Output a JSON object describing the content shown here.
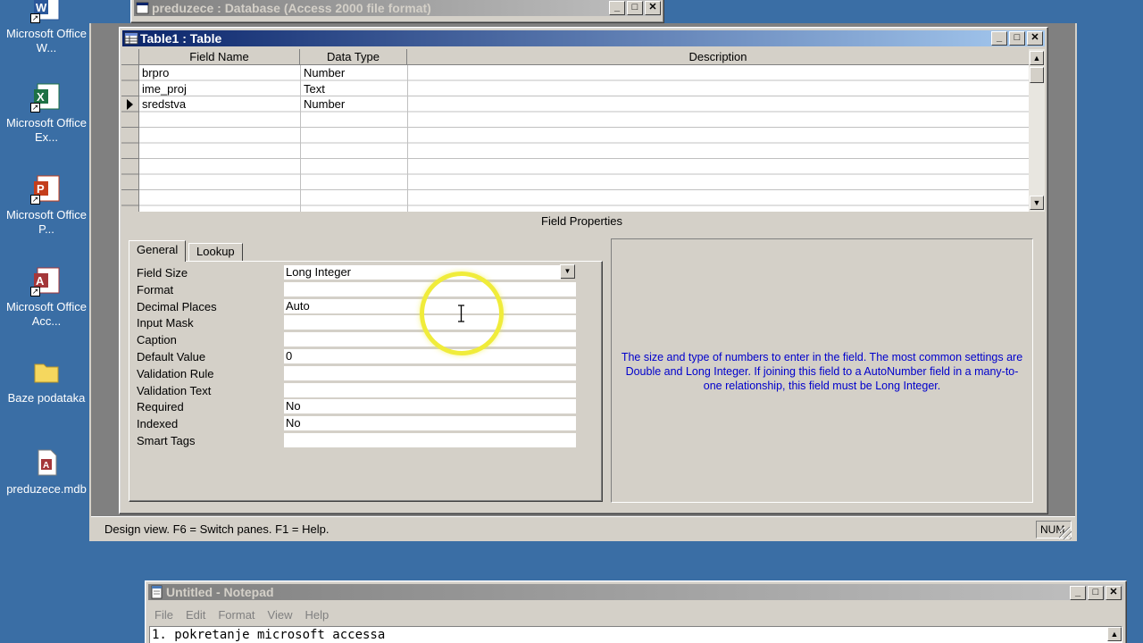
{
  "desktop": {
    "icons": [
      {
        "label": "Microsoft Office W...",
        "icon": "word-icon",
        "color": "#2b579a"
      },
      {
        "label": "Microsoft Office Ex...",
        "icon": "excel-icon",
        "color": "#1e7145"
      },
      {
        "label": "Microsoft Office P...",
        "icon": "powerpoint-icon",
        "color": "#c43e1c"
      },
      {
        "label": "Microsoft Office Acc...",
        "icon": "access-icon",
        "color": "#a4373a"
      },
      {
        "label": "Baze podataka",
        "icon": "folder-icon",
        "color": "#f5d75e"
      },
      {
        "label": "preduzece.mdb",
        "icon": "mdb-file-icon",
        "color": "#a4373a"
      }
    ]
  },
  "db_window": {
    "title": "preduzece : Database (Access 2000 file format)"
  },
  "access": {
    "status_text": "Design view.  F6 = Switch panes.  F1 = Help.",
    "num_indicator": "NUM"
  },
  "table_window": {
    "title": "Table1 : Table",
    "columns": {
      "field_name": "Field Name",
      "data_type": "Data Type",
      "description": "Description"
    },
    "rows": [
      {
        "field": "brpro",
        "type": "Number",
        "desc": ""
      },
      {
        "field": "ime_proj",
        "type": "Text",
        "desc": ""
      },
      {
        "field": "sredstva",
        "type": "Number",
        "desc": ""
      }
    ],
    "field_properties_label": "Field Properties",
    "tabs": {
      "general": "General",
      "lookup": "Lookup"
    },
    "properties": [
      {
        "label": "Field Size",
        "value": "Long Integer"
      },
      {
        "label": "Format",
        "value": ""
      },
      {
        "label": "Decimal Places",
        "value": "Auto"
      },
      {
        "label": "Input Mask",
        "value": ""
      },
      {
        "label": "Caption",
        "value": ""
      },
      {
        "label": "Default Value",
        "value": "0"
      },
      {
        "label": "Validation Rule",
        "value": ""
      },
      {
        "label": "Validation Text",
        "value": ""
      },
      {
        "label": "Required",
        "value": "No"
      },
      {
        "label": "Indexed",
        "value": "No"
      },
      {
        "label": "Smart Tags",
        "value": ""
      }
    ],
    "help_text": "The size and type of numbers to enter in the field.  The most common settings are Double and Long Integer.  If joining this field to a AutoNumber field in a many-to-one relationship, this field must be Long Integer."
  },
  "notepad": {
    "title": "Untitled - Notepad",
    "menu": [
      "File",
      "Edit",
      "Format",
      "View",
      "Help"
    ],
    "content": "1. pokretanje microsoft accessa"
  },
  "colors": {
    "help_text": "#0000cc",
    "highlight_ring": "#f0ec3a"
  }
}
